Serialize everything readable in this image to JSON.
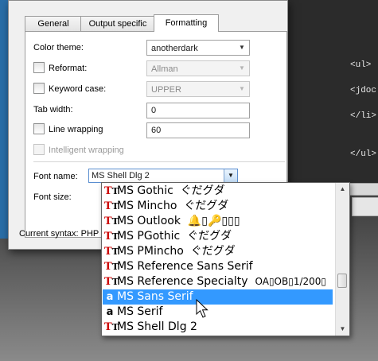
{
  "editor": {
    "lines": [
      "<ul>",
      "<jdoc",
      "</li>",
      "</ul>"
    ]
  },
  "tabs": [
    {
      "label": "General",
      "active": false
    },
    {
      "label": "Output specific",
      "active": false
    },
    {
      "label": "Formatting",
      "active": true
    }
  ],
  "formatting": {
    "color_theme_label": "Color theme:",
    "color_theme_value": "anotherdark",
    "reformat_label": "Reformat:",
    "reformat_value": "Allman",
    "keyword_case_label": "Keyword case:",
    "keyword_case_value": "UPPER",
    "tab_width_label": "Tab width:",
    "tab_width_value": "0",
    "line_wrapping_label": "Line wrapping",
    "line_wrapping_value": "60",
    "intelligent_wrapping_label": "Intelligent wrapping",
    "font_name_label": "Font name:",
    "font_name_value": "MS Shell Dlg 2",
    "font_size_label": "Font size:"
  },
  "status": {
    "current_syntax": "Current syntax: PHP"
  },
  "font_list": [
    {
      "name": "MS Gothic",
      "sample": "ぐだグダ",
      "icon": "truetype-icon",
      "selected": false
    },
    {
      "name": "MS Mincho",
      "sample": "ぐだグダ",
      "icon": "truetype-icon",
      "selected": false
    },
    {
      "name": "MS Outlook",
      "sample": "🔔▯🔑▯▯▯",
      "icon": "truetype-icon",
      "selected": false
    },
    {
      "name": "MS PGothic",
      "sample": "ぐだグダ",
      "icon": "truetype-icon",
      "selected": false
    },
    {
      "name": "MS PMincho",
      "sample": "ぐだグダ",
      "icon": "truetype-icon",
      "selected": false
    },
    {
      "name": "MS Reference Sans Serif",
      "sample": "",
      "icon": "truetype-icon",
      "selected": false
    },
    {
      "name": "MS Reference Specialty",
      "sample": "OA▯OB▯1/200▯",
      "icon": "truetype-icon",
      "selected": false
    },
    {
      "name": "MS Sans Serif",
      "sample": "",
      "icon": "raster-font-icon",
      "selected": true
    },
    {
      "name": "MS Serif",
      "sample": "",
      "icon": "raster-font-icon",
      "selected": false
    },
    {
      "name": "MS Shell Dlg 2",
      "sample": "",
      "icon": "truetype-icon",
      "selected": false
    }
  ],
  "colors": {
    "selection": "#3399ff",
    "editor_bg": "#2b2b2b"
  }
}
